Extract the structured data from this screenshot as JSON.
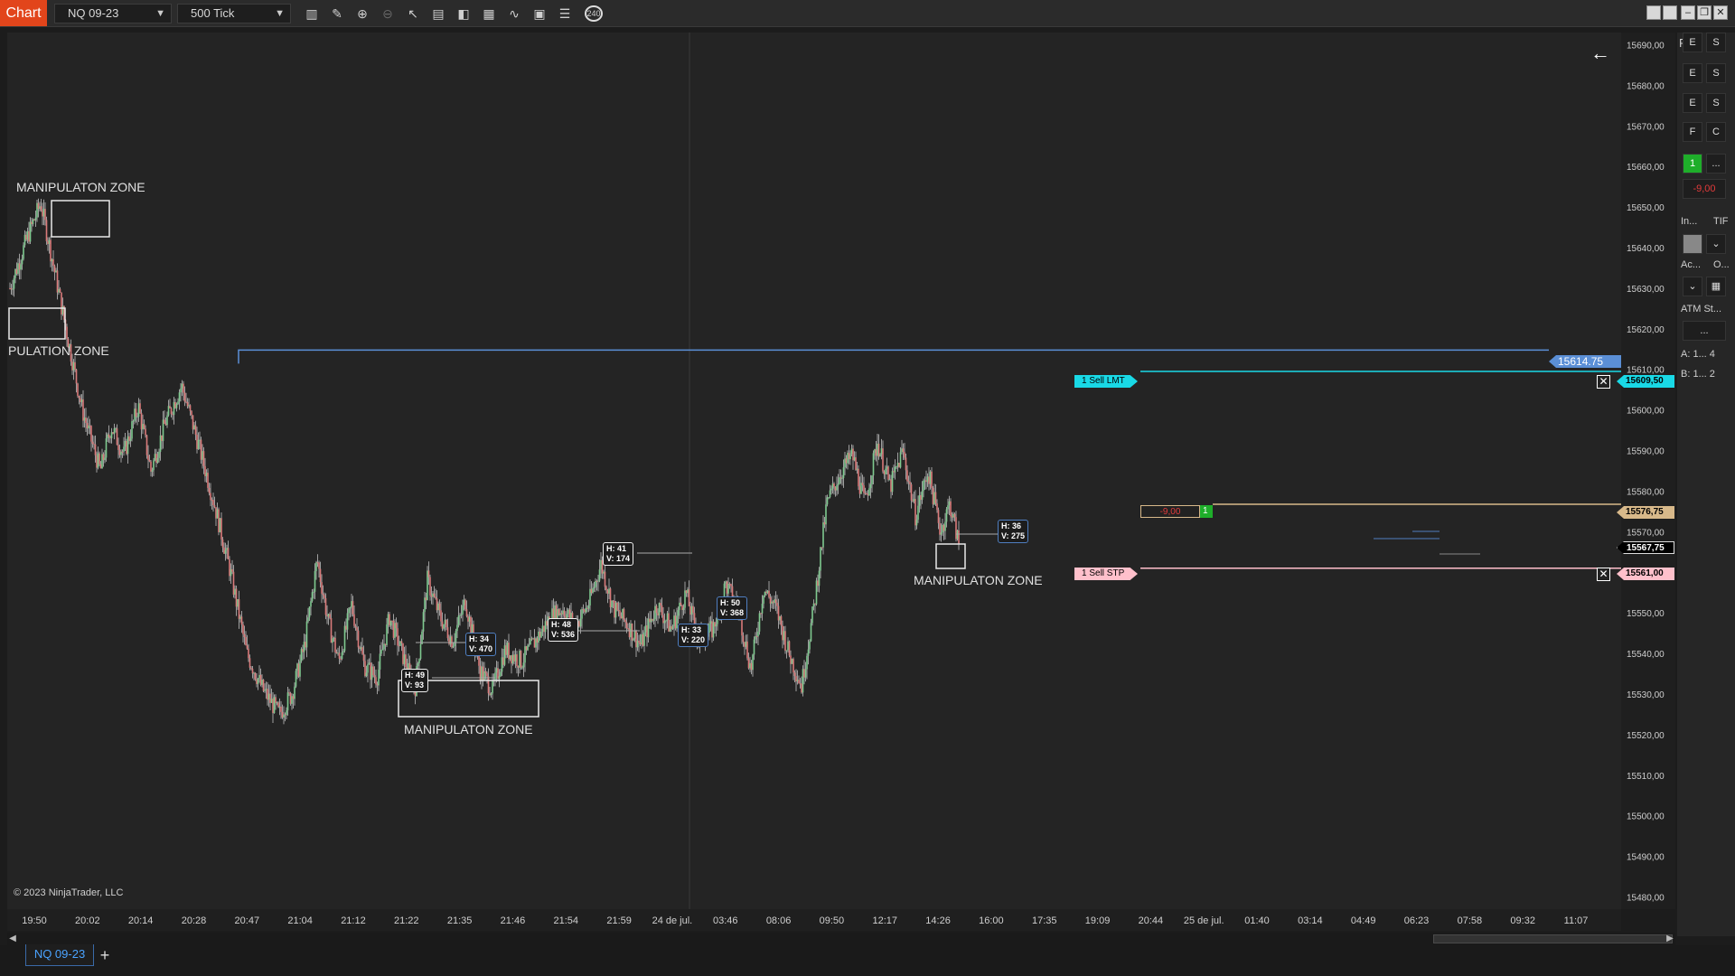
{
  "toolbar": {
    "chart_tab": "Chart",
    "instrument": "NQ 09-23",
    "interval": "500 Tick",
    "clock_badge": "240"
  },
  "copyright": "© 2023 NinjaTrader, LLC",
  "price_axis": {
    "labels": [
      "15690,00",
      "15680,00",
      "15670,00",
      "15660,00",
      "15650,00",
      "15640,00",
      "15630,00",
      "15620,00",
      "15610,00",
      "15600,00",
      "15590,00",
      "15580,00",
      "15570,00",
      "15560,00",
      "15550,00",
      "15540,00",
      "15530,00",
      "15520,00",
      "15510,00",
      "15500,00",
      "15490,00",
      "15480,00"
    ],
    "top_value": 15693,
    "bottom_value": 15477
  },
  "time_axis": {
    "labels": [
      "19:50",
      "20:02",
      "20:14",
      "20:28",
      "20:47",
      "21:04",
      "21:12",
      "21:22",
      "21:35",
      "21:46",
      "21:54",
      "21:59",
      "24 de jul.",
      "03:46",
      "08:06",
      "09:50",
      "12:17",
      "14:26",
      "16:00",
      "17:35",
      "19:09",
      "20:44",
      "25 de jul.",
      "01:40",
      "03:14",
      "04:49",
      "06:23",
      "07:58",
      "09:32",
      "11:07"
    ]
  },
  "zones": [
    {
      "label": "MANIPULATON ZONE"
    },
    {
      "label": "PULATION ZONE"
    },
    {
      "label": "MANIPULATON ZONE"
    },
    {
      "label": "MANIPULATON ZONE"
    }
  ],
  "levels": {
    "high_line": {
      "price": 15614.75,
      "label": "15614.75",
      "color": "#5b8fd6"
    },
    "sell_lmt": {
      "price": 15609.5,
      "label": "1  Sell LMT",
      "axis_label": "15609,50",
      "color": "#19d9e6"
    },
    "position": {
      "price": 15576.75,
      "pnl": "-9,00",
      "qty": "1",
      "axis_label": "15576,75",
      "color": "#d8b98a"
    },
    "last_price": {
      "price": 15567.75,
      "axis_label": "15567,75"
    },
    "sell_stp": {
      "price": 15561.0,
      "label": "1  Sell STP",
      "axis_label": "15561,00",
      "color": "#ffc0cb"
    }
  },
  "hv_boxes": [
    {
      "h": "H: 41",
      "v": "V: 174"
    },
    {
      "h": "H: 48",
      "v": "V: 536"
    },
    {
      "h": "H: 34",
      "v": "V: 470"
    },
    {
      "h": "H: 49",
      "v": "V: 93"
    },
    {
      "h": "H: 33",
      "v": "V: 220"
    },
    {
      "h": "H: 50",
      "v": "V: 368"
    },
    {
      "h": "H: 36",
      "v": "V: 275"
    }
  ],
  "side_panel": {
    "qty": "1",
    "more": "...",
    "pnl": "-9,00",
    "instrument_label": "In...",
    "tif_label": "TIF",
    "account_label": "Ac...",
    "o_label": "O...",
    "atm_label": "ATM St...",
    "atm_value": "...",
    "ask": "A:  1...  4",
    "bid": "B:  1...  2",
    "f_label": "F"
  },
  "bottom": {
    "instrument_tab": "NQ 09-23",
    "add_tab": "+"
  }
}
